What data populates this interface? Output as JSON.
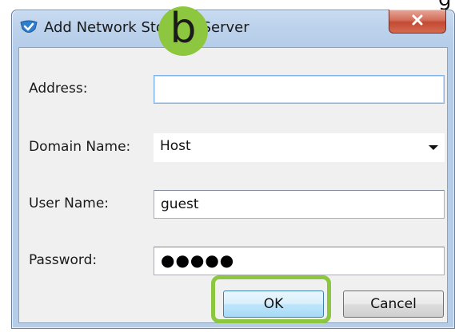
{
  "dialog": {
    "title": "Add Network Storage Server",
    "close_glyph": "x",
    "close_icon": "close-icon",
    "app_icon": "check-shield-icon"
  },
  "fields": {
    "address": {
      "label": "Address:",
      "value": ""
    },
    "domain_name": {
      "label": "Domain Name:",
      "value": "Host",
      "dropdown_icon": "chevron-down-icon"
    },
    "user_name": {
      "label": "User Name:",
      "value": "guest"
    },
    "password": {
      "label": "Password:",
      "masked_value": "●●●●●"
    }
  },
  "buttons": {
    "ok": "OK",
    "cancel": "Cancel"
  },
  "annotation": {
    "badge_letter": "b",
    "highlight_color": "#8dc63f"
  },
  "background_scrap": "g"
}
